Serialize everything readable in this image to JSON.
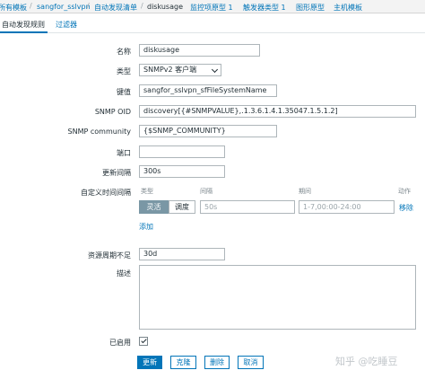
{
  "breadcrumb": {
    "items": [
      "所有模板",
      "sangfor_sslvpn",
      "自动发现清单",
      "diskusage",
      "监控项原型 1",
      "触发器类型 1",
      "图形原型",
      "主机模板"
    ],
    "separator": "/"
  },
  "subtabs": [
    "自动发现规则",
    "过滤器"
  ],
  "form": {
    "name": {
      "label": "名称",
      "value": "diskusage"
    },
    "type": {
      "label": "类型",
      "value": "SNMPv2 客户端"
    },
    "key": {
      "label": "键值",
      "value": "sangfor_sslvpn_sfFileSystemName"
    },
    "snmp_oid": {
      "label": "SNMP OID",
      "value": "discovery[{#SNMPVALUE},.1.3.6.1.4.1.35047.1.5.1.2]"
    },
    "snmp_community": {
      "label": "SNMP community",
      "value": "{$SNMP_COMMUNITY}"
    },
    "port": {
      "label": "端口",
      "value": ""
    },
    "update_interval": {
      "label": "更新间隔",
      "value": "300s"
    },
    "custom_intervals": {
      "label": "自定义时间间隔",
      "headers": [
        "类型",
        "间隔",
        "期间",
        "动作"
      ],
      "type_options": [
        "灵活",
        "调度"
      ],
      "interval_placeholder": "50s",
      "period_placeholder": "1-7,00:00-24:00",
      "remove_label": "移除",
      "add_label": "添加"
    },
    "lifetime": {
      "label": "资源周期不足",
      "value": "30d"
    },
    "description": {
      "label": "描述",
      "value": ""
    },
    "enabled": {
      "label": "已启用",
      "checked": true
    }
  },
  "buttons": {
    "update": "更新",
    "clone": "克隆",
    "delete": "删除",
    "cancel": "取消"
  },
  "watermark": "知乎 @吃睡豆",
  "colors": {
    "link": "#0275b8",
    "primary": "#0275b8",
    "segment_active": "#7a97a5"
  }
}
